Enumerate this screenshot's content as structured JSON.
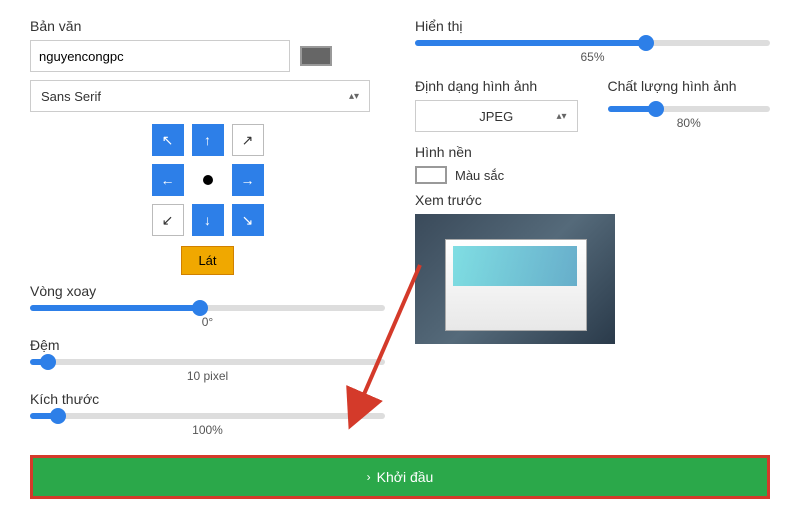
{
  "left": {
    "text_label": "Bản văn",
    "text_value": "nguyencongpc",
    "font_value": "Sans Serif",
    "tile_label": "Lát",
    "rotation_label": "Vòng xoay",
    "rotation_value": "0°",
    "padding_label": "Đệm",
    "padding_value": "10 pixel",
    "size_label": "Kích thước",
    "size_value": "100%"
  },
  "right": {
    "display_label": "Hiển thị",
    "display_value": "65%",
    "format_label": "Định dạng hình ảnh",
    "format_value": "JPEG",
    "quality_label": "Chất lượng hình ảnh",
    "quality_value": "80%",
    "background_label": "Hình nền",
    "background_mode": "Màu sắc",
    "preview_label": "Xem trước"
  },
  "start_label": "Khởi đầu",
  "sliders": {
    "rotation_pct": 48,
    "padding_pct": 5,
    "size_pct": 8,
    "display_pct": 65,
    "quality_pct": 30
  }
}
